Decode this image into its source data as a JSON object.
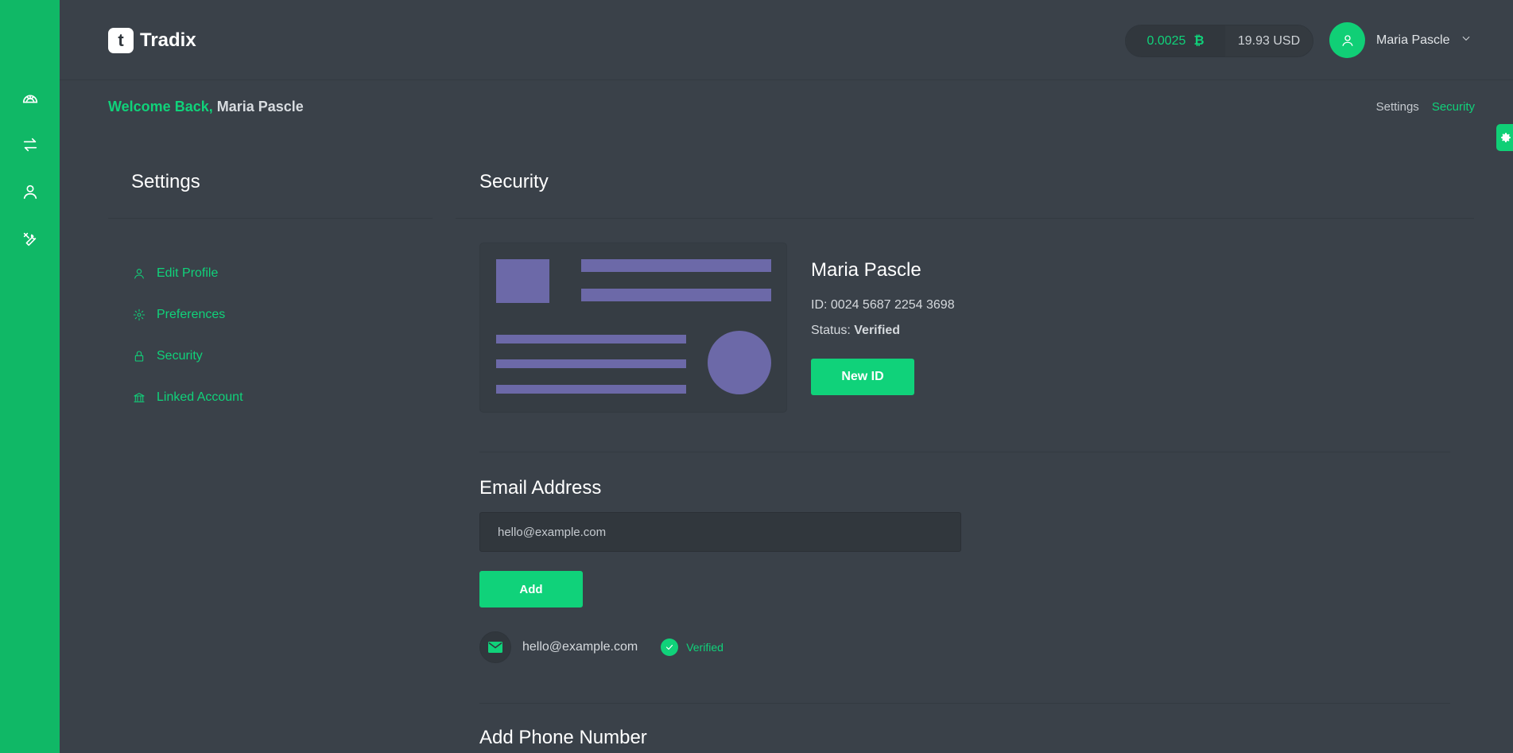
{
  "brand": {
    "name": "Tradix",
    "mark": "t"
  },
  "header": {
    "balance_crypto": "0.0025",
    "balance_crypto_icon": "bitcoin-icon",
    "balance_fiat": "19.93 USD",
    "user_name": "Maria Pascle"
  },
  "welcome": {
    "greeting": "Welcome Back,",
    "name": "Maria Pascle"
  },
  "breadcrumb": {
    "parent": "Settings",
    "current": "Security"
  },
  "sidebar_rail": [
    "dashboard-icon",
    "exchange-icon",
    "profile-icon",
    "tools-icon"
  ],
  "settings": {
    "title": "Settings",
    "nav": [
      {
        "label": "Edit Profile",
        "icon": "user-icon"
      },
      {
        "label": "Preferences",
        "icon": "gear-icon"
      },
      {
        "label": "Security",
        "icon": "lock-icon"
      },
      {
        "label": "Linked Account",
        "icon": "bank-icon"
      }
    ]
  },
  "security": {
    "title": "Security",
    "id_name": "Maria Pascle",
    "id_number": "ID: 0024 5687 2254 3698",
    "status_label": "Status:",
    "status_value": "Verified",
    "new_id_button": "New ID",
    "email_title": "Email Address",
    "email_placeholder": "hello@example.com",
    "add_button": "Add",
    "email_listed": "hello@example.com",
    "email_verified": "Verified",
    "phone_title": "Add Phone Number"
  },
  "colors": {
    "accent": "#10d27a",
    "rail": "#10b866",
    "background": "#3a4149",
    "id_illustration": "#6c69a8"
  }
}
